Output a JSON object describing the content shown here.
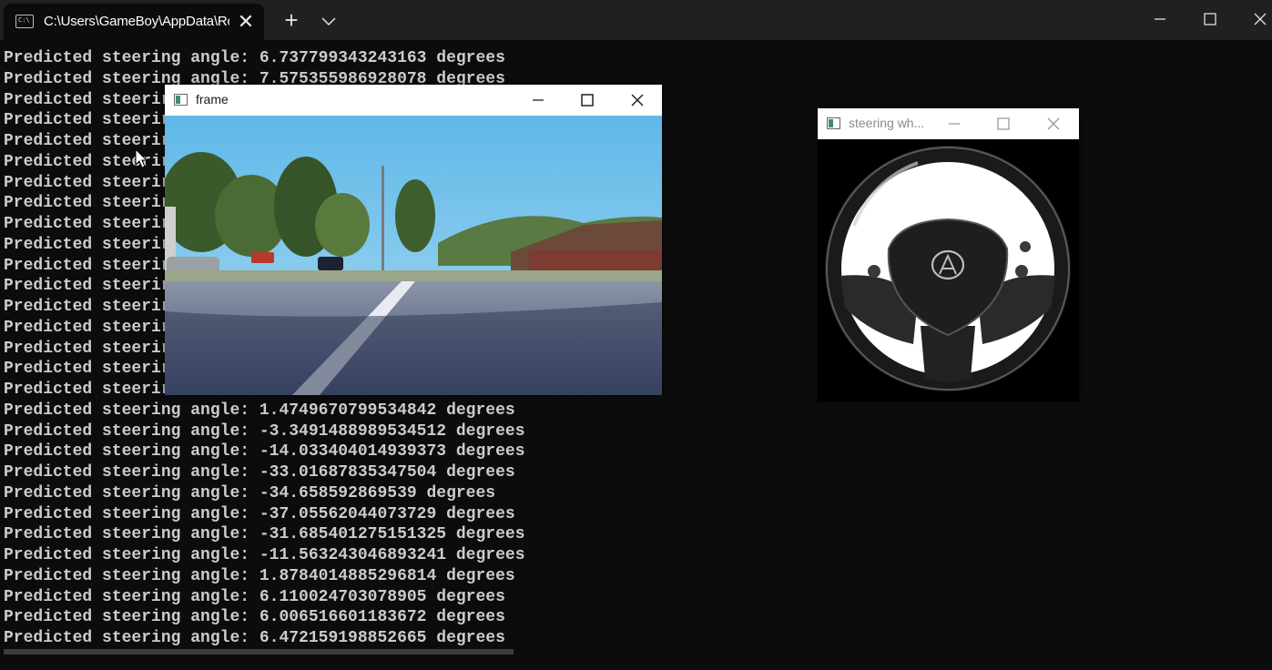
{
  "terminal_tab": {
    "title": "C:\\Users\\GameBoy\\AppData\\Rc",
    "icon": "console-icon",
    "icon_text": "C:\\",
    "close_label": "✕",
    "new_tab_label": "+"
  },
  "window_controls": [
    "minimize-icon",
    "maximize-icon",
    "close-icon"
  ],
  "terminal_lines": [
    "Predicted steering angle: 6.737799343243163 degrees",
    "Predicted steering angle: 7.575355986928078 degrees",
    "Predicted steerir",
    "Predicted steerir",
    "Predicted steerir",
    "Predicted steerir",
    "Predicted steerir",
    "Predicted steerir",
    "Predicted steerir",
    "Predicted steerir",
    "Predicted steerir",
    "Predicted steerir",
    "Predicted steerir",
    "Predicted steerir",
    "Predicted steerir",
    "Predicted steerir",
    "Predicted steerir",
    "Predicted steering angle: 1.4749670799534842 degrees",
    "Predicted steering angle: -3.3491488989534512 degrees",
    "Predicted steering angle: -14.033404014939373 degrees",
    "Predicted steering angle: -33.01687835347504 degrees",
    "Predicted steering angle: -34.658592869539 degrees",
    "Predicted steering angle: -37.05562044073729 degrees",
    "Predicted steering angle: -31.685401275151325 degrees",
    "Predicted steering angle: -11.563243046893241 degrees",
    "Predicted steering angle: 1.8784014885296814 degrees",
    "Predicted steering angle: 6.110024703078905 degrees",
    "Predicted steering angle: 6.006516601183672 degrees",
    "Predicted steering angle: 6.472159198852665 degrees"
  ],
  "frame_window": {
    "title": "frame",
    "image": "dashcam road scene"
  },
  "wheel_window": {
    "title": "steering wh...",
    "image": "steering wheel"
  },
  "colors": {
    "terminal_bg": "#0c0c0c",
    "terminal_text": "#cccccc",
    "tabbar_bg": "#202020"
  }
}
